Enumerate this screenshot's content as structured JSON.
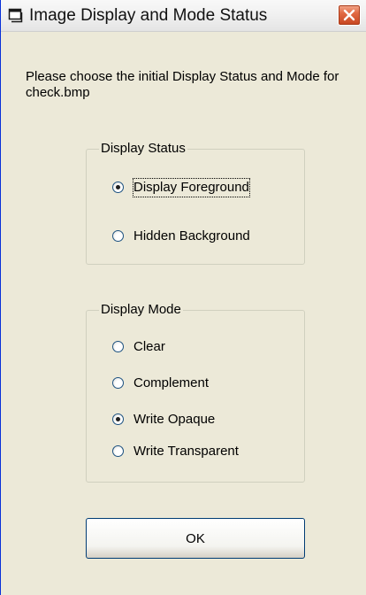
{
  "window": {
    "title": "Image Display and Mode Status",
    "app_icon": "window-app-icon",
    "close_icon": "close-x-icon"
  },
  "instructions": "Please choose the initial Display Status and Mode for check.bmp",
  "display_status": {
    "legend": "Display Status",
    "options": [
      {
        "label": "Display Foreground",
        "checked": true,
        "focused": true
      },
      {
        "label": "Hidden Background",
        "checked": false
      }
    ]
  },
  "display_mode": {
    "legend": "Display Mode",
    "options": [
      {
        "label": "Clear",
        "checked": false
      },
      {
        "label": "Complement",
        "checked": false
      },
      {
        "label": "Write Opaque",
        "checked": true
      },
      {
        "label": "Write Transparent",
        "checked": false
      }
    ]
  },
  "ok_button": {
    "label": "OK"
  },
  "colors": {
    "dialog_background": "#ece9d8",
    "close_button": "#e26a44",
    "button_border": "#003c74"
  }
}
